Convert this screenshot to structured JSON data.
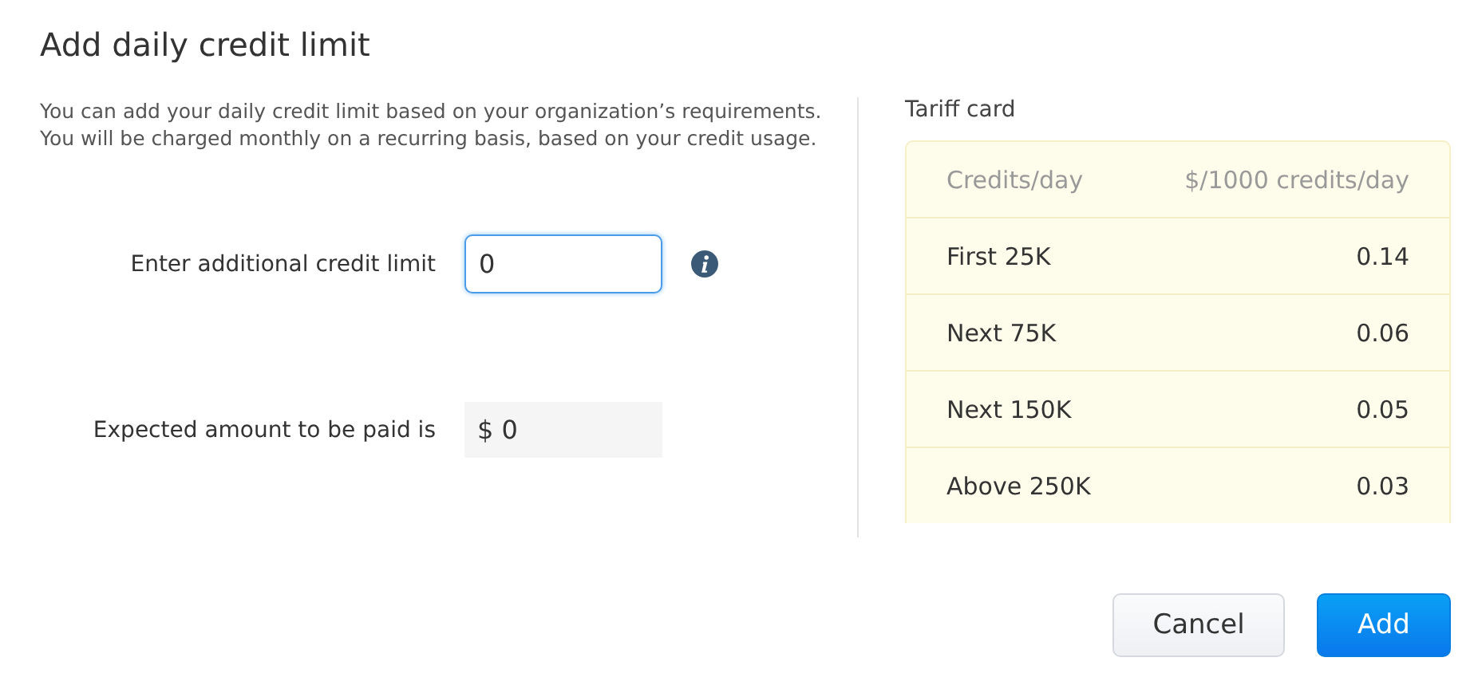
{
  "title": "Add daily credit limit",
  "description": "You can add your daily credit limit based on your organization’s requirements. You will be charged monthly on a recurring basis, based on your credit usage.",
  "fields": [
    {
      "label": "Enter additional credit limit",
      "value": "0",
      "kind": "input"
    },
    {
      "label": "Expected amount to be paid is",
      "value": "$ 0",
      "kind": "readonly"
    }
  ],
  "tariff": {
    "title": "Tariff card",
    "columns": [
      "Credits/day",
      "$/1000 credits/day"
    ],
    "rows": [
      [
        "First 25K",
        "0.14"
      ],
      [
        "Next 75K",
        "0.06"
      ],
      [
        "Next 150K",
        "0.05"
      ],
      [
        "Above 250K",
        "0.03"
      ]
    ]
  },
  "buttons": [
    {
      "label": "Cancel",
      "kind": "secondary"
    },
    {
      "label": "Add",
      "kind": "primary"
    }
  ]
}
